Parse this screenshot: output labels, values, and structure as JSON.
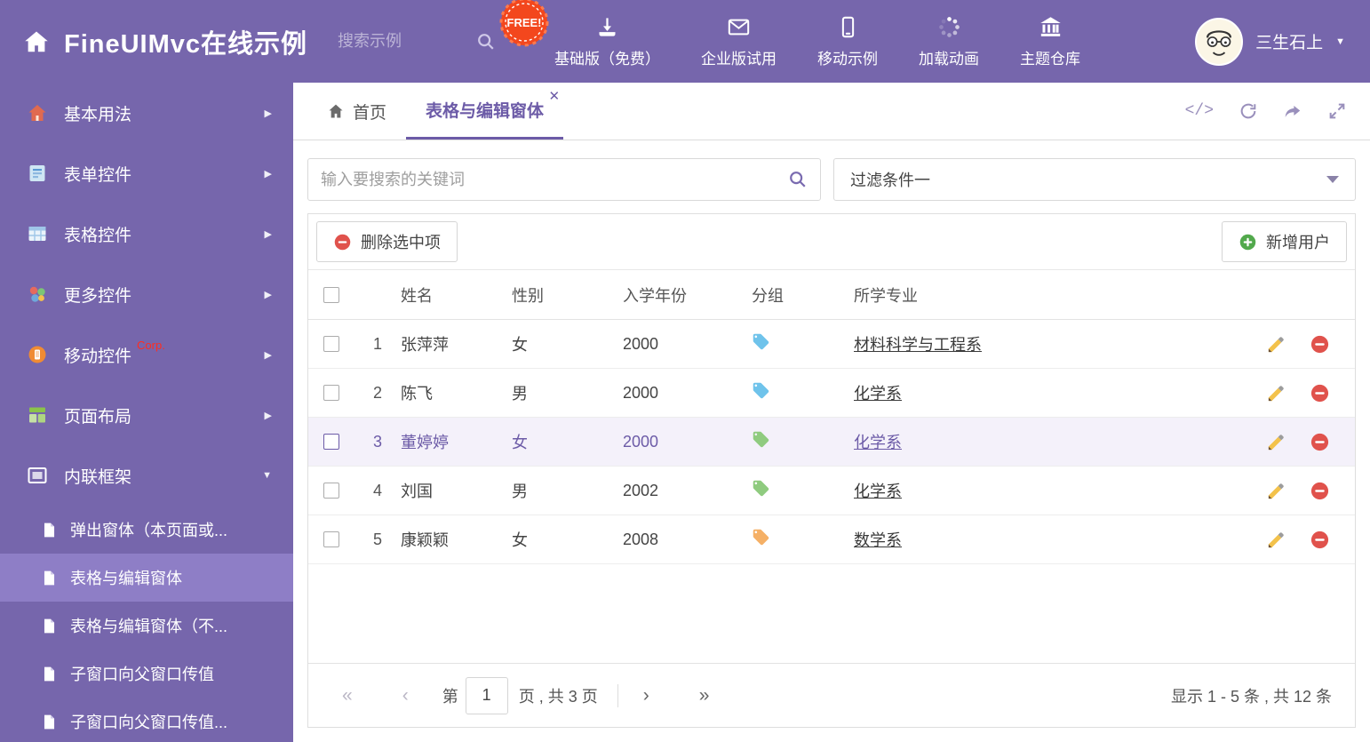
{
  "header": {
    "title": "FineUIMvc在线示例",
    "search_placeholder": "搜索示例",
    "free_badge": "FREE!",
    "nav": [
      {
        "label": "基础版（免费）",
        "icon": "download-icon"
      },
      {
        "label": "企业版试用",
        "icon": "mail-icon"
      },
      {
        "label": "移动示例",
        "icon": "mobile-icon"
      },
      {
        "label": "加载动画",
        "icon": "spinner-icon"
      },
      {
        "label": "主题仓库",
        "icon": "bank-icon"
      }
    ],
    "user": {
      "name": "三生石上"
    }
  },
  "sidebar": {
    "items": [
      {
        "label": "基本用法",
        "icon": "home-icon"
      },
      {
        "label": "表单控件",
        "icon": "form-icon"
      },
      {
        "label": "表格控件",
        "icon": "table-icon"
      },
      {
        "label": "更多控件",
        "icon": "more-controls-icon"
      },
      {
        "label": "移动控件",
        "icon": "mobile-controls-icon",
        "badge": "Corp."
      },
      {
        "label": "页面布局",
        "icon": "layout-icon"
      },
      {
        "label": "内联框架",
        "icon": "iframe-icon"
      }
    ],
    "subitems": [
      {
        "label": "弹出窗体（本页面或..."
      },
      {
        "label": "表格与编辑窗体",
        "active": true
      },
      {
        "label": "表格与编辑窗体（不..."
      },
      {
        "label": "子窗口向父窗口传值"
      },
      {
        "label": "子窗口向父窗口传值..."
      }
    ]
  },
  "tabs": {
    "home": {
      "label": "首页",
      "icon": "home-icon"
    },
    "active": {
      "label": "表格与编辑窗体",
      "close_glyph": "✕"
    },
    "actions": [
      "code-icon",
      "refresh-icon",
      "forward-icon",
      "fullscreen-icon"
    ],
    "code_glyph": "</>"
  },
  "filters": {
    "search_placeholder": "输入要搜索的关键词",
    "filter_value": "过滤条件一"
  },
  "grid": {
    "delete_button": "删除选中项",
    "add_button": "新增用户",
    "columns": {
      "name": "姓名",
      "gender": "性别",
      "year": "入学年份",
      "group": "分组",
      "major": "所学专业"
    },
    "rows": [
      {
        "index": "1",
        "name": "张萍萍",
        "gender": "女",
        "year": "2000",
        "tag_color": "#6FC3EB",
        "major": "材料科学与工程系"
      },
      {
        "index": "2",
        "name": "陈飞",
        "gender": "男",
        "year": "2000",
        "tag_color": "#6FC3EB",
        "major": "化学系"
      },
      {
        "index": "3",
        "name": "董婷婷",
        "gender": "女",
        "year": "2000",
        "tag_color": "#8FCB7F",
        "major": "化学系",
        "selected": true
      },
      {
        "index": "4",
        "name": "刘国",
        "gender": "男",
        "year": "2002",
        "tag_color": "#8FCB7F",
        "major": "化学系"
      },
      {
        "index": "5",
        "name": "康颖颖",
        "gender": "女",
        "year": "2008",
        "tag_color": "#F5B066",
        "major": "数学系"
      }
    ]
  },
  "pagination": {
    "first": "«",
    "prev": "‹",
    "next": "›",
    "last": "»",
    "page_prefix": "第",
    "page_value": "1",
    "page_suffix": "页 , 共 3 页",
    "summary": "显示 1 - 5 条 , 共 12 条"
  },
  "colors": {
    "theme_purple": "#7666AC",
    "active_purple": "#6C5BA7",
    "selected_row_bg": "#F4F1FA",
    "delete_red": "#E0524C",
    "add_green": "#52A94C",
    "free_badge_red": "#F3471D"
  }
}
